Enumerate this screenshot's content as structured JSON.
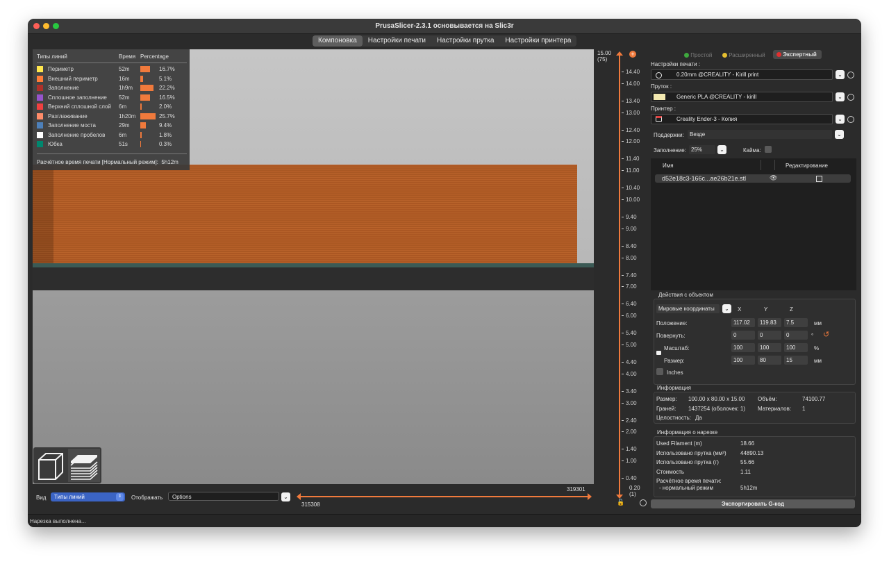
{
  "window": {
    "title": "PrusaSlicer-2.3.1 основывается на Slic3r"
  },
  "tabs": [
    "Компоновка",
    "Настройки печати",
    "Настройки прутка",
    "Настройки принтера"
  ],
  "legend": {
    "headers": [
      "Типы линий",
      "Время",
      "Percentage"
    ],
    "rows": [
      {
        "name": "Периметр",
        "time": "52m",
        "pct": "16.7%",
        "color": "#ffe64d",
        "value": 16.7
      },
      {
        "name": "Внешний периметр",
        "time": "16m",
        "pct": "5.1%",
        "color": "#ff7d38",
        "value": 5.1
      },
      {
        "name": "Заполнение",
        "time": "1h9m",
        "pct": "22.2%",
        "color": "#b03029",
        "value": 22.2
      },
      {
        "name": "Сплошное заполнение",
        "time": "52m",
        "pct": "16.5%",
        "color": "#9654cc",
        "value": 16.5
      },
      {
        "name": "Верхний сплошной слой",
        "time": "6m",
        "pct": "2.0%",
        "color": "#f04040",
        "value": 2.0
      },
      {
        "name": "Разглаживание",
        "time": "1h20m",
        "pct": "25.7%",
        "color": "#ff8c69",
        "value": 25.7
      },
      {
        "name": "Заполнение моста",
        "time": "29m",
        "pct": "9.4%",
        "color": "#4d80ba",
        "value": 9.4
      },
      {
        "name": "Заполнение пробелов",
        "time": "6m",
        "pct": "1.8%",
        "color": "#ffffff",
        "value": 1.8
      },
      {
        "name": "Юбка",
        "time": "51s",
        "pct": "0.3%",
        "color": "#00876e",
        "value": 0.3
      }
    ],
    "total_label": "Расчётное время печати [Нормальный режим]:",
    "total_value": "5h12m"
  },
  "bottom_bar": {
    "view_label": "Вид",
    "view_value": "Типы линий",
    "show_label": "Отображать",
    "show_value": "Options",
    "h_slider_max": "319301",
    "h_slider_min": "315308"
  },
  "vertical_slider": {
    "top_value": "15.00",
    "top_layer": "(75)",
    "bottom_value": "0.20",
    "bottom_layer": "(1)",
    "ticks": [
      "15.00",
      "14.40",
      "14.00",
      "13.40",
      "13.00",
      "12.40",
      "12.00",
      "11.40",
      "11.00",
      "10.40",
      "10.00",
      "9.40",
      "9.00",
      "8.40",
      "8.00",
      "7.40",
      "7.00",
      "6.40",
      "6.00",
      "5.40",
      "5.00",
      "4.40",
      "4.00",
      "3.40",
      "3.00",
      "2.40",
      "2.00",
      "1.40",
      "1.00",
      "0.40"
    ]
  },
  "mode": {
    "simple": "Простой",
    "advanced": "Расширенный",
    "expert": "Экспертный"
  },
  "print_settings": {
    "label": "Настройки печати :",
    "value": "0.20mm @CREALITY - Kirill print"
  },
  "filament": {
    "label": "Пруток :",
    "value": "Generic PLA @CREALITY - kirill",
    "color": "#f3e9b0"
  },
  "printer": {
    "label": "Принтер :",
    "value": "Creality Ender-3 - Копия"
  },
  "supports": {
    "label": "Поддержки:",
    "value": "Везде"
  },
  "infill": {
    "label": "Заполнение:",
    "value": "25%"
  },
  "brim": {
    "label": "Кайма:"
  },
  "objects": {
    "col_name": "Имя",
    "col_edit": "Редактирование",
    "item": "d52e18c3-166c...ae26b21e.stl"
  },
  "manipulation": {
    "title": "Действия с объектом",
    "coords": "Мировые координаты",
    "axes": [
      "X",
      "Y",
      "Z"
    ],
    "position_label": "Положение:",
    "position": [
      "117.02",
      "119.83",
      "7.5"
    ],
    "position_unit": "мм",
    "rotate_label": "Повернуть:",
    "rotate": [
      "0",
      "0",
      "0"
    ],
    "rotate_unit": "°",
    "scale_label": "Масштаб:",
    "scale": [
      "100",
      "100",
      "100"
    ],
    "scale_unit": "%",
    "size_label": "Размер:",
    "size": [
      "100",
      "80",
      "15"
    ],
    "size_unit": "мм",
    "inches": "Inches"
  },
  "info": {
    "title": "Информация",
    "size_label": "Размер:",
    "size_value": "100.00 x 80.00 x 15.00",
    "volume_label": "Объём:",
    "volume_value": "74100.77",
    "facets_label": "Граней:",
    "facets_value": "1437254 (оболочек: 1)",
    "materials_label": "Материалов:",
    "materials_value": "1",
    "manifold_label": "Целостность:",
    "manifold_value": "Да"
  },
  "slice_info": {
    "title": "Информация о нарезке",
    "rows": [
      {
        "label": "Used Filament (m)",
        "value": "18.66"
      },
      {
        "label": "Использовано прутка (мм³)",
        "value": "44890.13"
      },
      {
        "label": "Использовано прутка (г)",
        "value": "55.66"
      },
      {
        "label": "Стоимость",
        "value": "1.11"
      }
    ],
    "time_label": "Расчётное время печати:",
    "time_sub": "- нормальный режим",
    "time_value": "5h12m"
  },
  "export_button": "Экспортировать G-код",
  "status": "Нарезка выполнена...",
  "colors": {
    "accent": "#f07a3c",
    "part": "#b25a22"
  }
}
